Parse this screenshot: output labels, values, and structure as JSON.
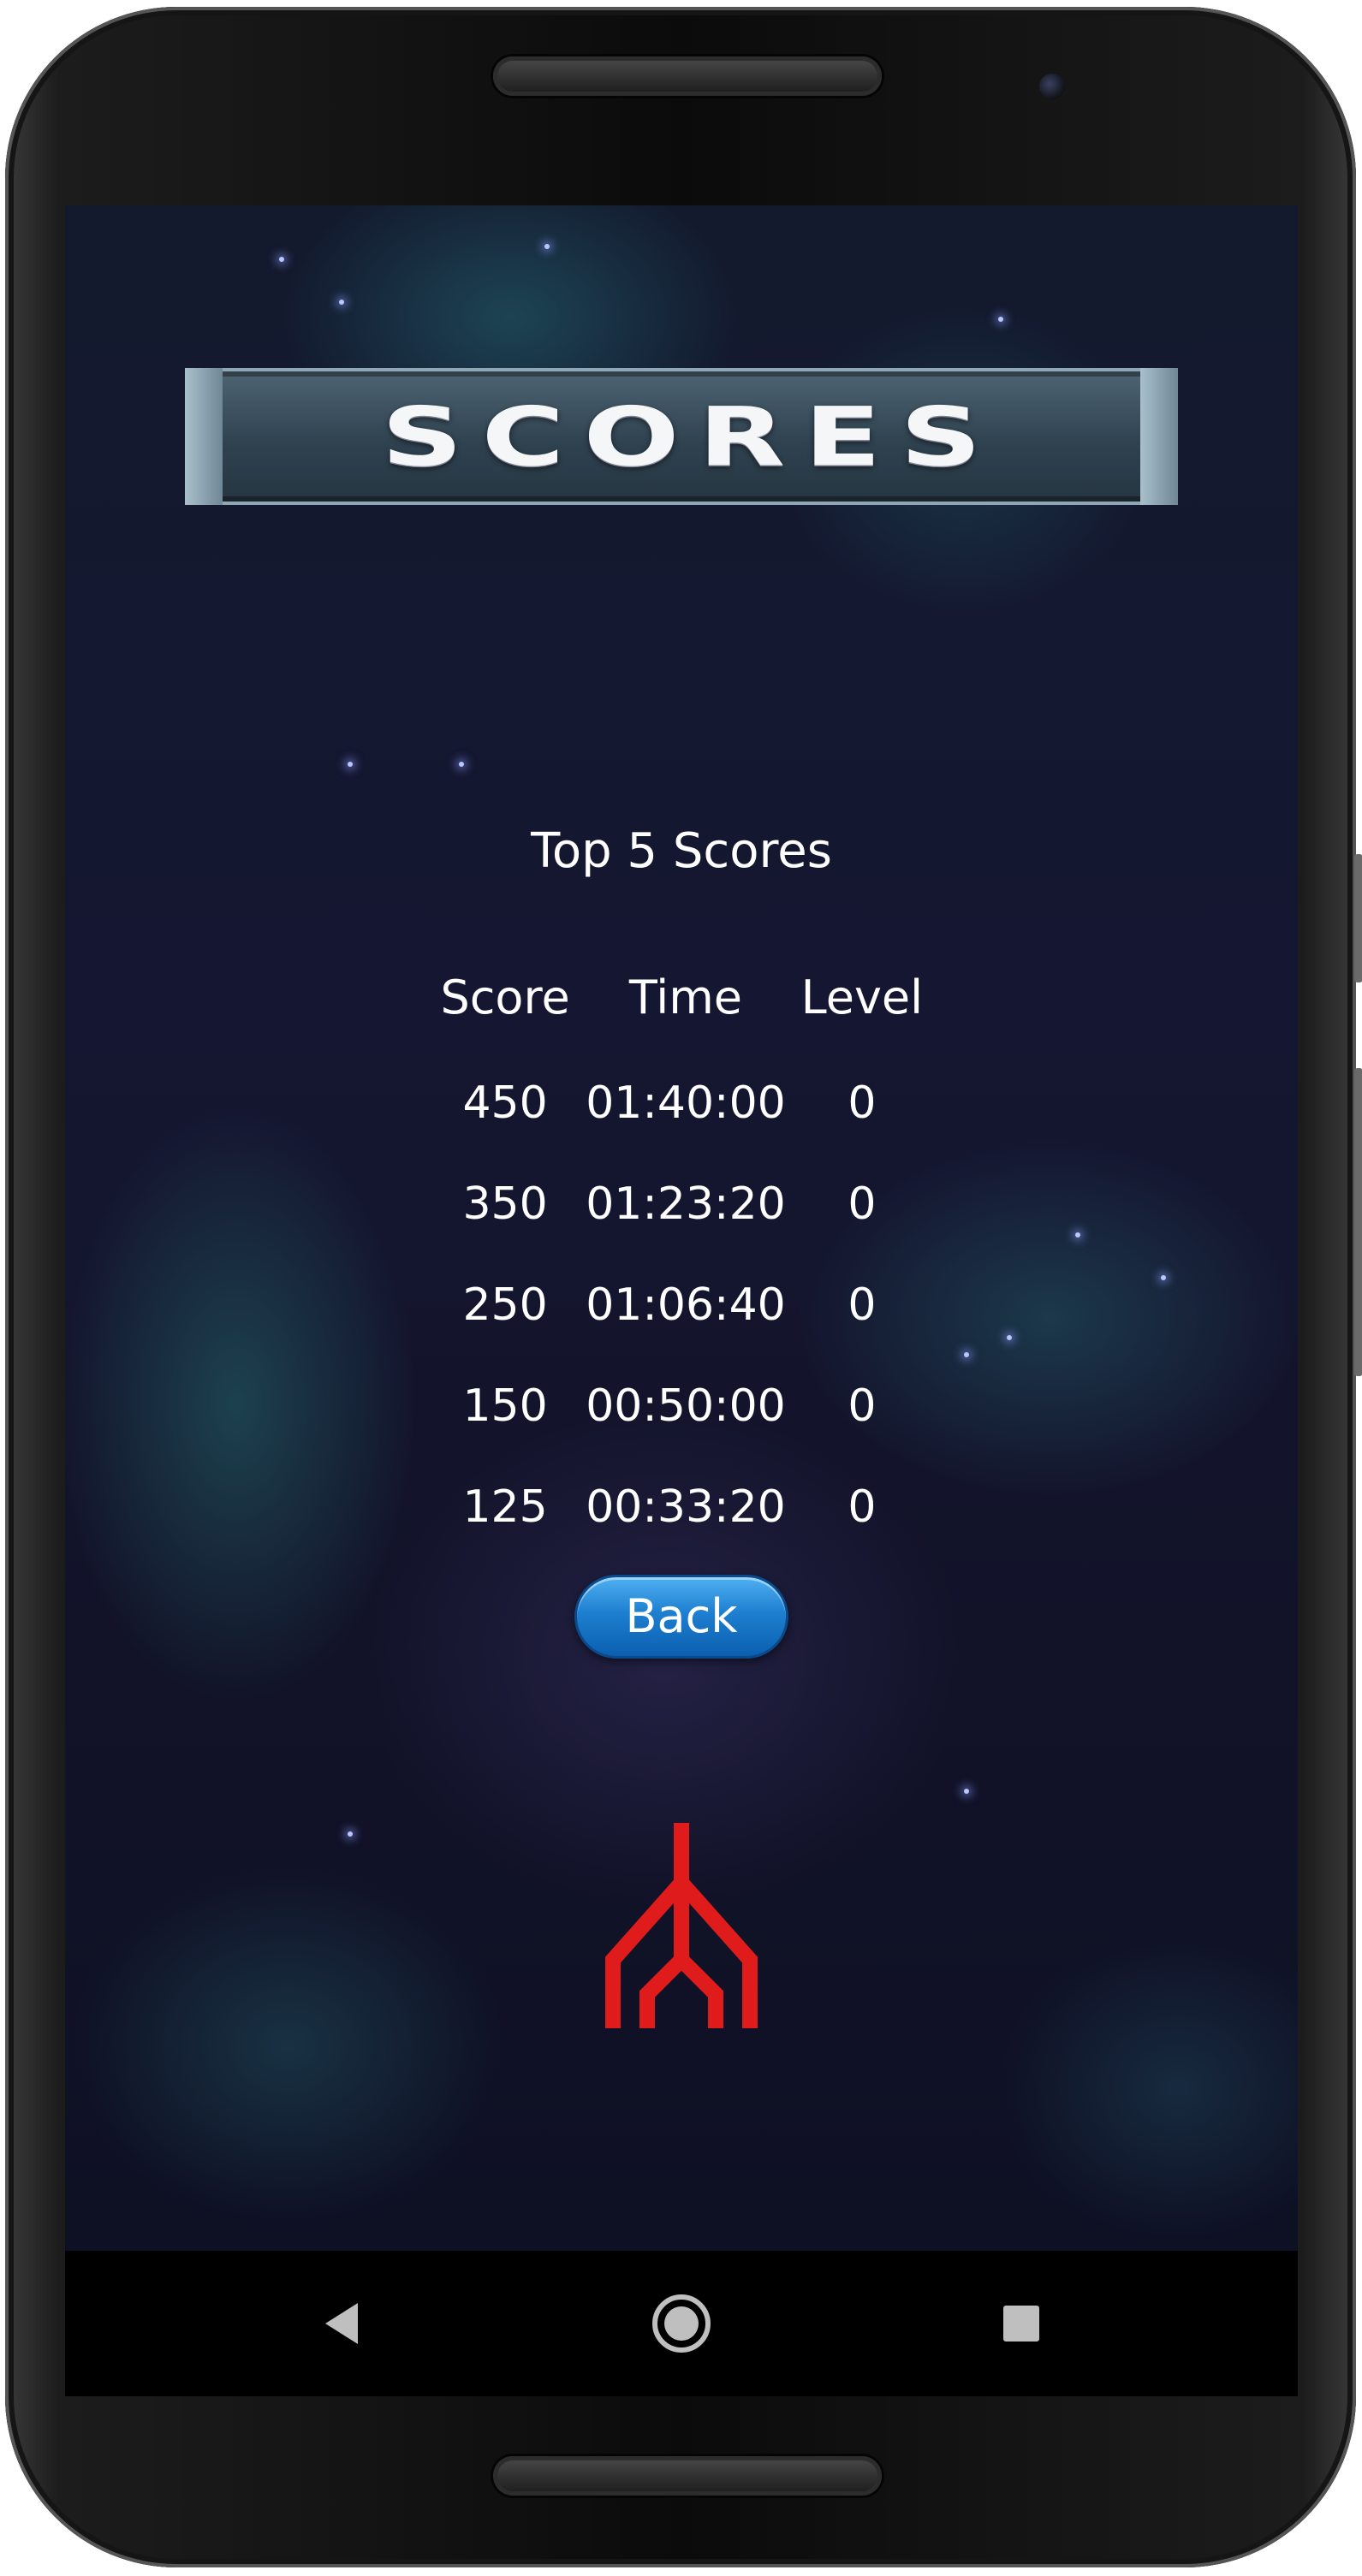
{
  "banner": {
    "title": "SCORES"
  },
  "scores": {
    "heading": "Top 5 Scores",
    "columns": [
      "Score",
      "Time",
      "Level"
    ],
    "rows": [
      [
        "450",
        "01:40:00",
        "0"
      ],
      [
        "350",
        "01:23:20",
        "0"
      ],
      [
        "250",
        "01:06:40",
        "0"
      ],
      [
        "150",
        "00:50:00",
        "0"
      ],
      [
        "125",
        "00:33:20",
        "0"
      ]
    ]
  },
  "back_button": {
    "label": "Back",
    "color": "#1e7fd0"
  },
  "ship": {
    "icon": "spaceship-icon",
    "color": "#e01b1b"
  },
  "navbar": {
    "icons": [
      "nav-back-icon",
      "nav-home-icon",
      "nav-recents-icon"
    ],
    "color": "#bfbfbf"
  }
}
